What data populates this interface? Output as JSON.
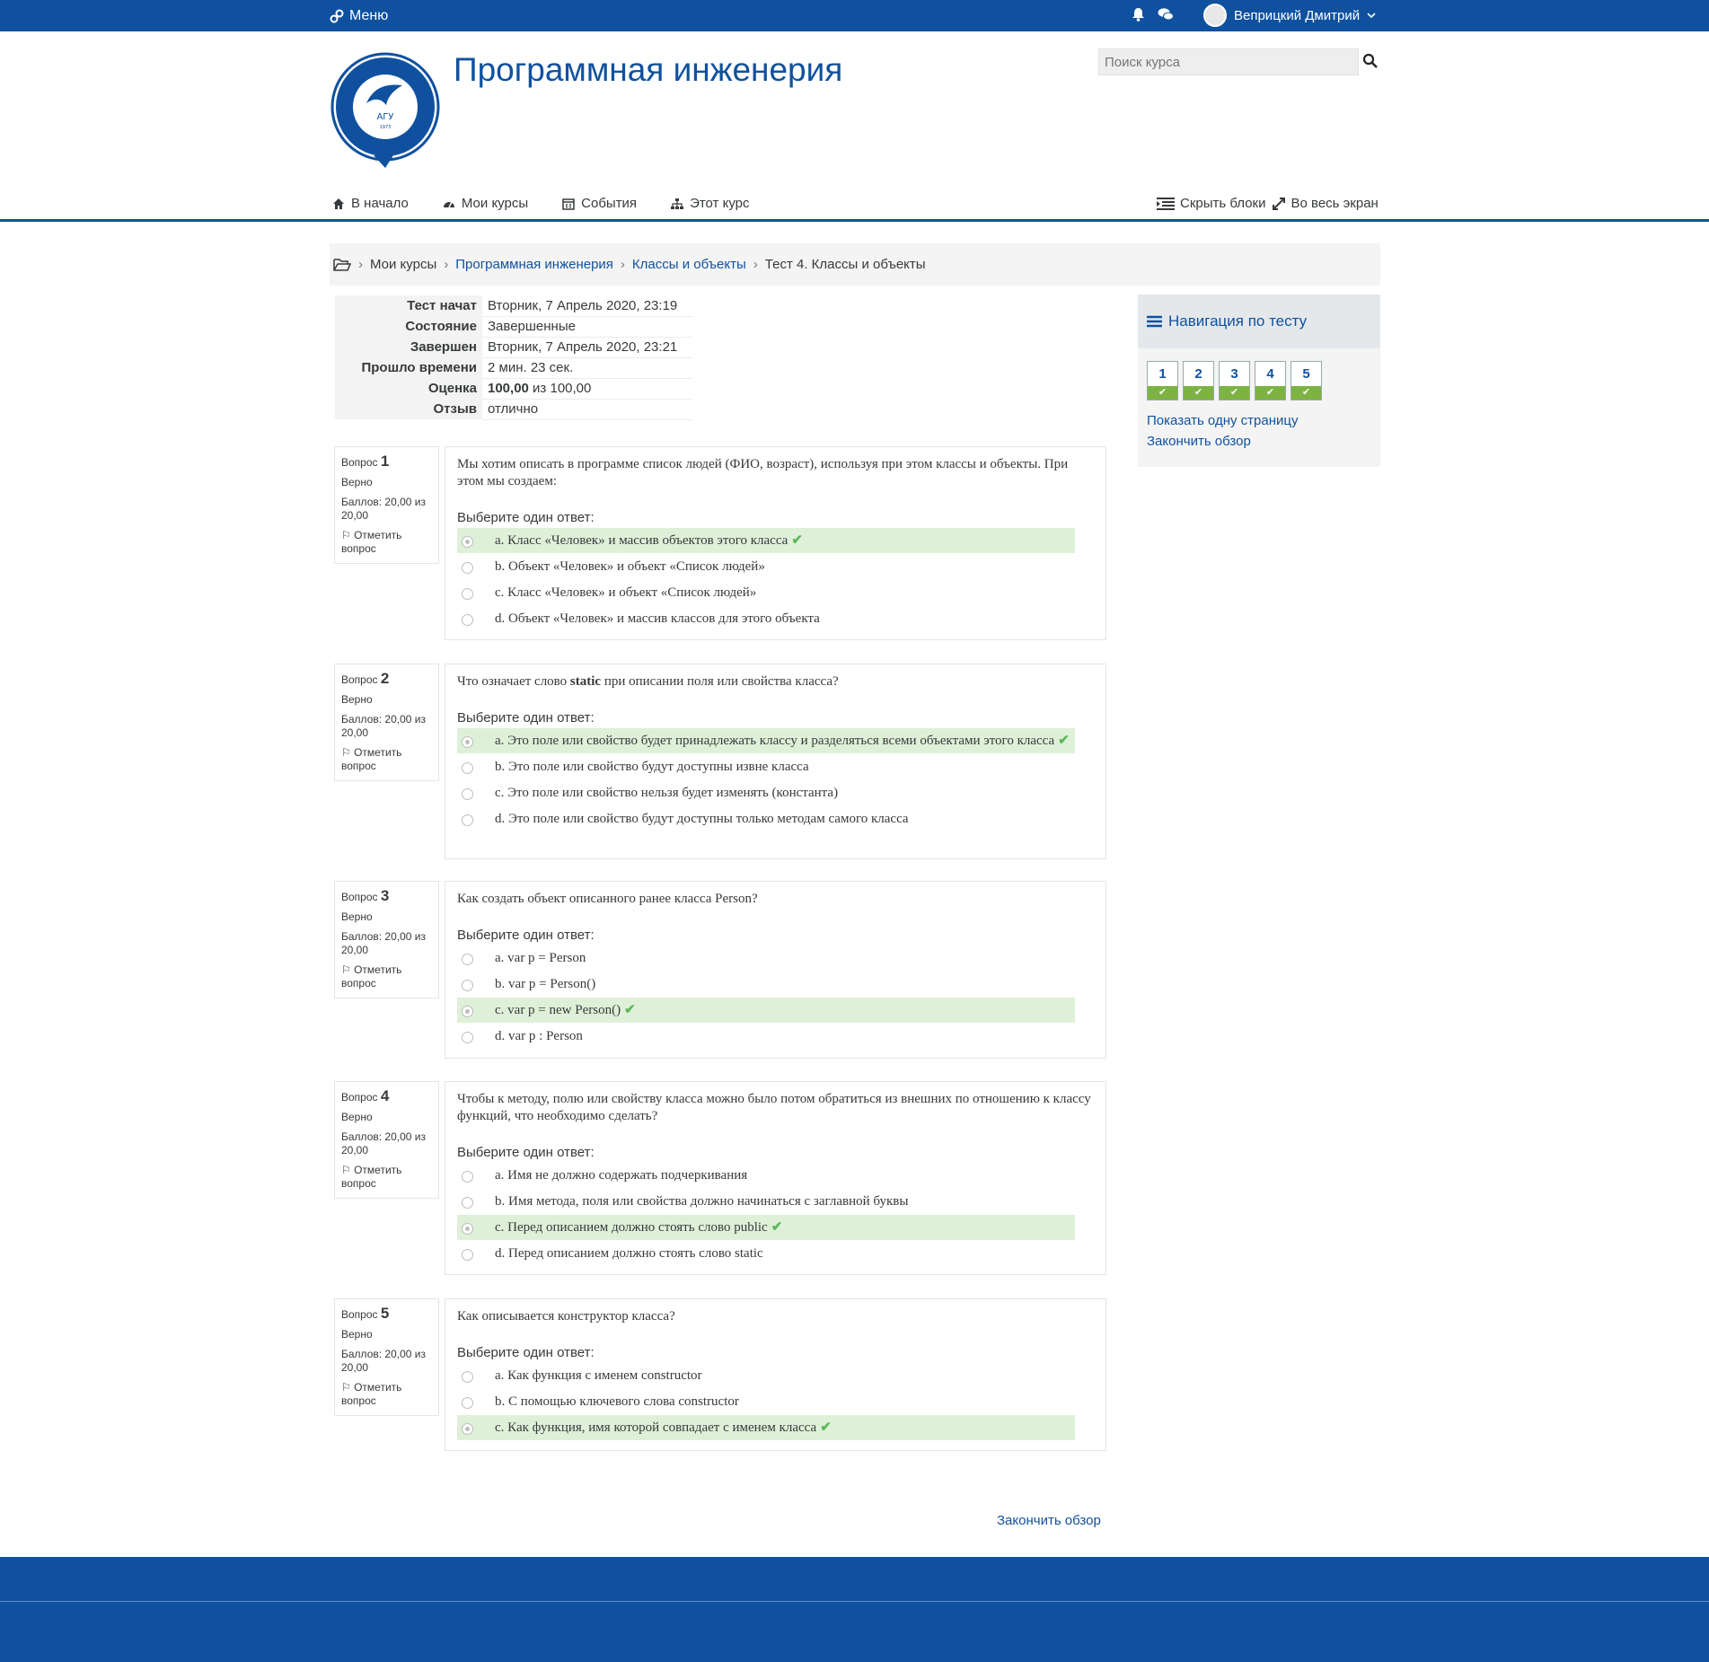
{
  "topbar": {
    "menu_label": "Меню",
    "user_name": "Веприцкий Дмитрий"
  },
  "header": {
    "course_title": "Программная инженерия",
    "search_placeholder": "Поиск курса"
  },
  "nav": {
    "items": [
      {
        "label": "В начало",
        "icon": "home-icon"
      },
      {
        "label": "Мои курсы",
        "icon": "dashboard-icon"
      },
      {
        "label": "События",
        "icon": "calendar-icon"
      },
      {
        "label": "Этот курс",
        "icon": "sitemap-icon"
      }
    ],
    "hide_blocks": "Скрыть блоки",
    "fullscreen": "Во весь экран"
  },
  "breadcrumb": {
    "items": [
      "Мои курсы",
      "Программная инженерия",
      "Классы и объекты",
      "Тест 4. Классы и объекты"
    ]
  },
  "summary": {
    "rows": [
      {
        "k": "Тест начат",
        "v": "Вторник, 7 Апрель 2020, 23:19"
      },
      {
        "k": "Состояние",
        "v": "Завершенные"
      },
      {
        "k": "Завершен",
        "v": "Вторник, 7 Апрель 2020, 23:21"
      },
      {
        "k": "Прошло времени",
        "v": "2 мин. 23 сек."
      },
      {
        "k": "Оценка",
        "v_bold": "100,00",
        "v_rest": " из 100,00"
      },
      {
        "k": "Отзыв",
        "v": "отлично"
      }
    ]
  },
  "question_labels": {
    "q_word": "Вопрос",
    "state": "Верно",
    "points": "Баллов: 20,00 из 20,00",
    "flag": "Отметить вопрос",
    "choose": "Выберите один ответ:"
  },
  "questions": [
    {
      "num": "1",
      "text": "Мы хотим описать в программе список людей (ФИО, возраст), используя при этом классы и объекты. При этом мы создаем:",
      "answers": [
        "a. Класс «Человек» и массив объектов этого класса",
        "b. Объект «Человек» и объект «Список людей»",
        "c. Класс «Человек» и объект «Список людей»",
        "d. Объект «Человек» и массив классов для этого объекта"
      ],
      "correct": 0
    },
    {
      "num": "2",
      "text_pre": "Что означает слово ",
      "text_bold": "static",
      "text_post": " при описании поля или свойства класса?",
      "answers": [
        "a. Это поле или свойство будет принадлежать классу и разделяться всеми объектами этого класса",
        "b. Это поле или свойство будут доступны извне класса",
        "c. Это поле или свойство нельзя будет изменять (константа)",
        "d. Это поле или свойство будут доступны только методам самого класса"
      ],
      "correct": 0
    },
    {
      "num": "3",
      "text": "Как создать объект описанного ранее класса Person?",
      "answers": [
        "a. var p = Person",
        "b. var p = Person()",
        "c. var p = new Person()",
        "d. var p : Person"
      ],
      "correct": 2
    },
    {
      "num": "4",
      "text": "Чтобы к методу, полю или свойству класса можно было потом обратиться из внешних по отношению к классу функций, что необходимо сделать?",
      "answers": [
        "a. Имя не должно содержать подчеркивания",
        "b. Имя метода, поля или свойства должно начинаться с заглавной буквы",
        "c. Перед описанием должно стоять слово public",
        "d. Перед описанием должно стоять слово static"
      ],
      "correct": 2
    },
    {
      "num": "5",
      "text": "Как описывается конструктор класса?",
      "answers": [
        "a. Как функция с именем constructor",
        "b. С помощью ключевого слова constructor",
        "c. Как функция, имя которой совпадает с именем класса"
      ],
      "correct": 2
    }
  ],
  "quiz_nav": {
    "title": "Навигация по тесту",
    "buttons": [
      "1",
      "2",
      "3",
      "4",
      "5"
    ],
    "show_one_page": "Показать одну страницу",
    "finish_review": "Закончить обзор"
  },
  "finish_review_bottom": "Закончить обзор",
  "colors": {
    "brand": "#0f519e",
    "correct_bg": "#dff0d8",
    "check": "#5cb85c"
  }
}
